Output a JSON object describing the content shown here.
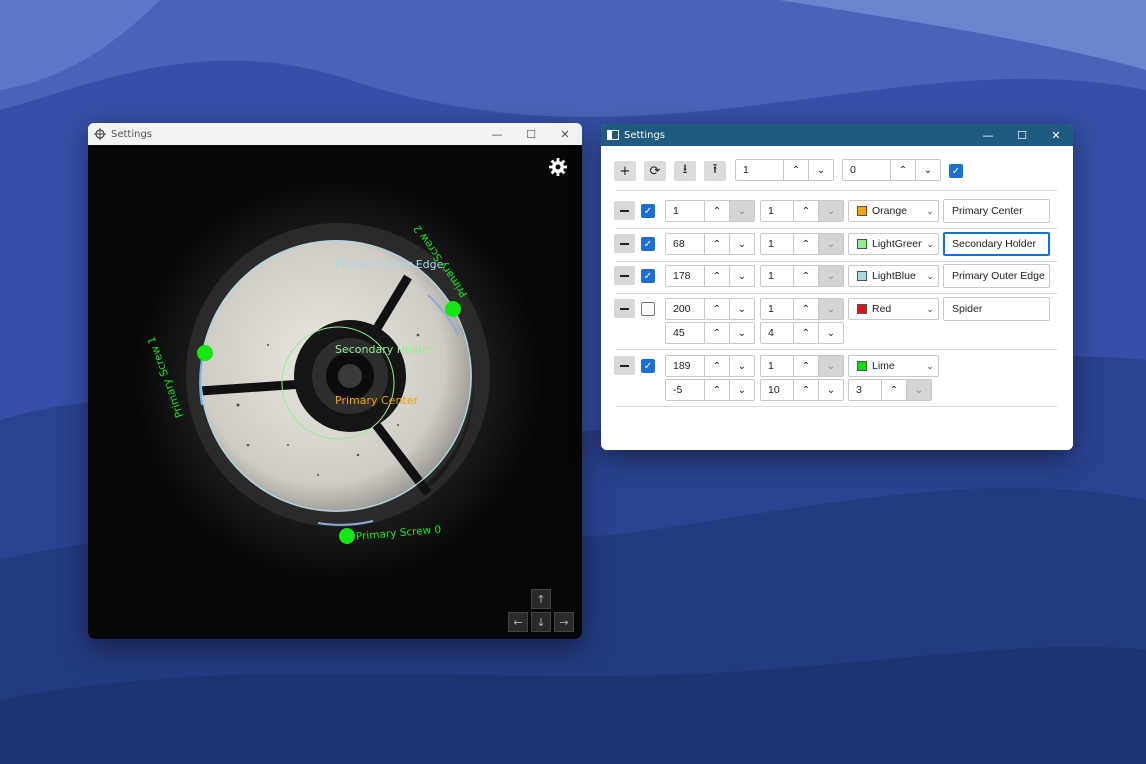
{
  "camera_window": {
    "title": "Settings",
    "overlay_labels": {
      "primary_outer_edge": "Primary Outer Edge",
      "secondary_holder": "Secondary Holder",
      "primary_center": "Primary Center",
      "screw_0": "Primary Screw 0",
      "screw_1": "Primary Screw 1",
      "screw_2": "Primary Screw 2"
    },
    "nav": {
      "up": "↑",
      "left": "←",
      "down": "↓",
      "right": "→"
    }
  },
  "settings_window": {
    "title": "Settings",
    "toolbar": {
      "add": "+",
      "refresh": "⟳",
      "download": "⭳",
      "upload": "⭱",
      "value_a": "1",
      "value_b": "0",
      "checked": true
    },
    "rows": [
      {
        "checked": true,
        "n1": "1",
        "n2": "1",
        "color_name": "Orange",
        "color": "#f5a300",
        "label": "Primary Center"
      },
      {
        "checked": true,
        "n1": "68",
        "n2": "1",
        "color_name": "LightGreen",
        "color": "#90ee90",
        "label": "Secondary Holder"
      },
      {
        "checked": true,
        "n1": "178",
        "n2": "1",
        "color_name": "LightBlue",
        "color": "#add8e6",
        "label": "Primary Outer Edge"
      },
      {
        "checked": false,
        "n1": "200",
        "n2": "1",
        "color_name": "Red",
        "color": "#e01010",
        "label": "Spider",
        "n3": "45",
        "n4": "4"
      },
      {
        "checked": true,
        "n1": "189",
        "n2": "1",
        "color_name": "Lime",
        "color": "#00e000",
        "n3": "-5",
        "n4": "10",
        "n5": "3"
      }
    ]
  },
  "colors": {
    "overlay_green": "#14e614",
    "orange": "#f0a000",
    "light_blue": "#a8d8ea",
    "light_green": "#90ee90"
  }
}
